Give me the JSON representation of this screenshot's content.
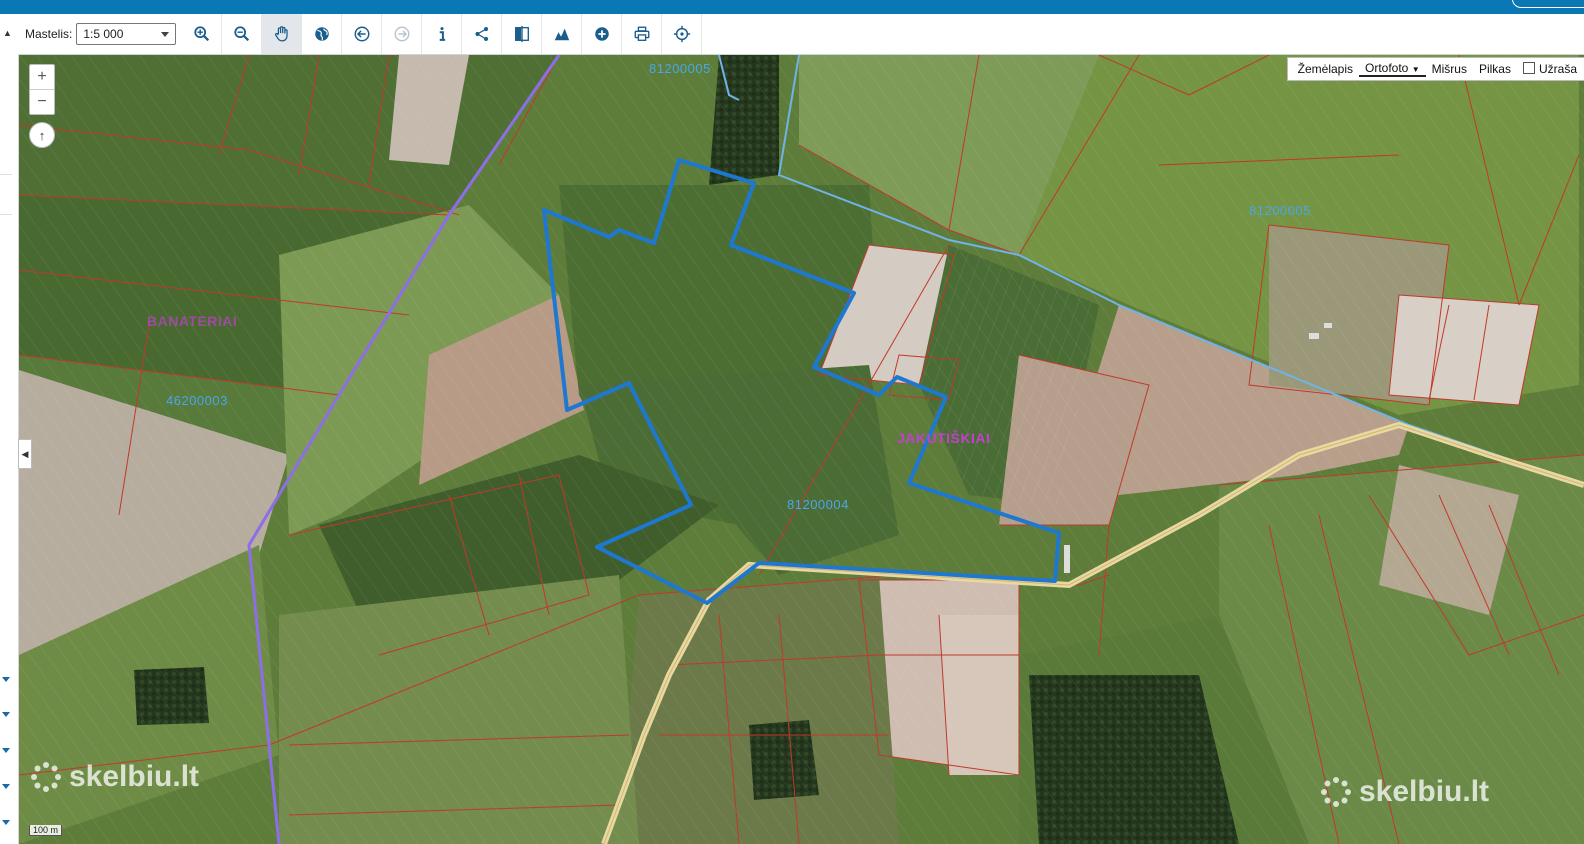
{
  "toolbar": {
    "scale_label": "Mastelis:",
    "scale_value": "1:5 000",
    "tools": [
      {
        "icon": "zoom-in-icon"
      },
      {
        "icon": "zoom-out-icon"
      },
      {
        "icon": "pan-hand-icon"
      },
      {
        "icon": "globe-icon"
      },
      {
        "icon": "back-arrow-icon"
      },
      {
        "icon": "forward-arrow-icon"
      },
      {
        "icon": "info-icon"
      },
      {
        "icon": "share-icon"
      },
      {
        "icon": "compare-icon"
      },
      {
        "icon": "profile-chart-icon"
      },
      {
        "icon": "add-icon"
      },
      {
        "icon": "print-icon"
      },
      {
        "icon": "locate-icon"
      }
    ]
  },
  "map": {
    "zoom_in": "+",
    "zoom_out": "−",
    "north": "↑",
    "layers": {
      "items": [
        "Žemėlapis",
        "Ortofoto",
        "Mišrus",
        "Pilkas"
      ],
      "selected": "Ortofoto",
      "labels_checkbox": "Užraša"
    },
    "labels": {
      "village_left": "BANATERIAI",
      "village_right": "JAKUTIŠKIAI",
      "cadastre_top": "81200005",
      "cadastre_right": "81200005",
      "cadastre_center": "81200004",
      "cadastre_left": "46200003"
    },
    "scalebar": "100 m",
    "watermark": "skelbiu.lt",
    "colors": {
      "parcel_outline": "#1e78d0",
      "cadastre_lines": "#c0392b",
      "road": "#e8d9a2",
      "municipal_border": "#8a6ee0"
    }
  }
}
